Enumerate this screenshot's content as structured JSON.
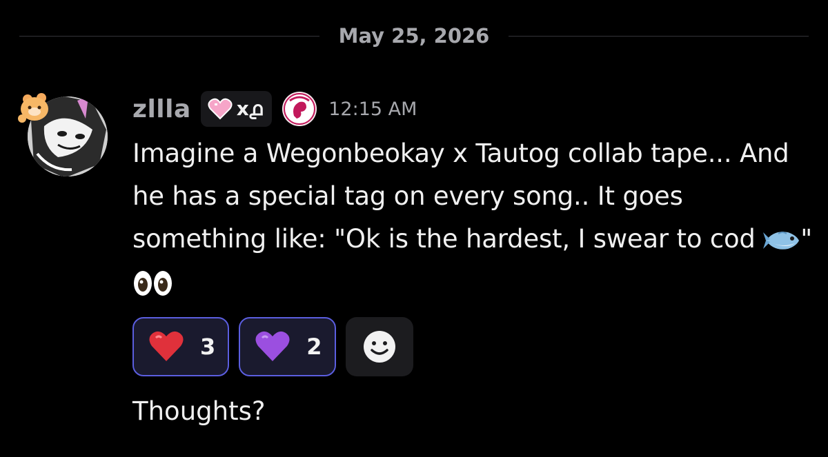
{
  "date_divider": {
    "label": "May 25, 2026"
  },
  "message": {
    "author": {
      "username": "zllla",
      "clan_tag": "x൧",
      "clan_badge_icon": "heart-icon",
      "role_badge_icon": "tautog-badge-icon",
      "avatar_icon": "character-avatar"
    },
    "timestamp": "12:15 AM",
    "text_part1": "Imagine a Wegonbeokay x Tautog collab tape... And he has a special tag on every song.. It goes something like: \"Ok is the hardest, I swear to cod",
    "text_part2": "\"",
    "inline_emojis": [
      "fish-emoji",
      "eyes-emoji"
    ],
    "reactions": [
      {
        "emoji": "red-heart-emoji",
        "count": "3",
        "color": "#e0313b"
      },
      {
        "emoji": "purple-heart-emoji",
        "count": "2",
        "color": "#9b4fe0"
      }
    ],
    "add_reaction_icon": "smiley-add-icon",
    "followup_text": "Thoughts?"
  },
  "colors": {
    "background": "#000000",
    "reaction_border": "#5b5ee0",
    "muted_text": "#a7a8ad"
  }
}
